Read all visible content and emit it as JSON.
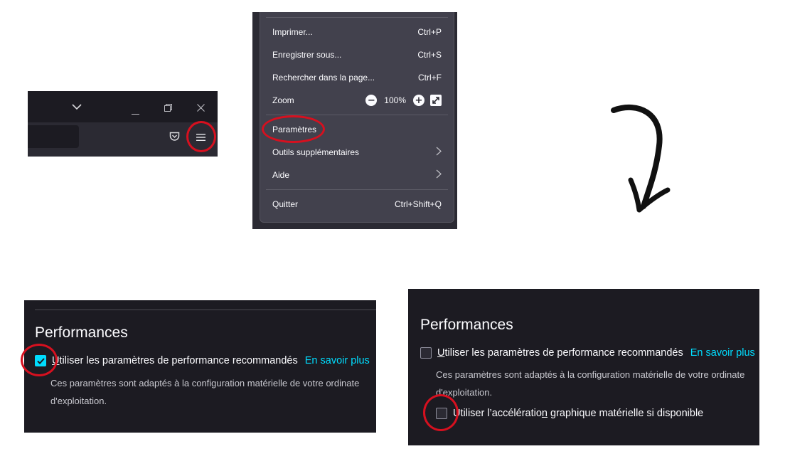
{
  "toolbar": {
    "icons": [
      "chevron-down-icon",
      "minimize-icon",
      "restore-icon",
      "close-icon",
      "pocket-icon",
      "hamburger-menu-icon"
    ]
  },
  "menu": {
    "items": [
      {
        "label": "Imprimer...",
        "shortcut": "Ctrl+P"
      },
      {
        "label": "Enregistrer sous...",
        "shortcut": "Ctrl+S"
      },
      {
        "label": "Rechercher dans la page...",
        "shortcut": "Ctrl+F"
      }
    ],
    "zoom": {
      "label": "Zoom",
      "minus": "−",
      "value": "100%",
      "plus": "+"
    },
    "settings_label": "Paramètres",
    "more_tools_label": "Outils supplémentaires",
    "help_label": "Aide",
    "quit": {
      "label": "Quitter",
      "shortcut": "Ctrl+Shift+Q"
    }
  },
  "before": {
    "title": "Performances",
    "recommended_label_first": "U",
    "recommended_label_rest": "tiliser les paramètres de performance recommandés",
    "learn_more": "En savoir plus",
    "desc_line1": "Ces paramètres sont adaptés à la configuration matérielle de votre ordinate",
    "desc_line2": "d'exploitation.",
    "recommended_checked": true
  },
  "after": {
    "title": "Performances",
    "recommended_label_first": "U",
    "recommended_label_rest": "tiliser les paramètres de performance recommandés",
    "learn_more": "En savoir plus",
    "desc_line1": "Ces paramètres sont adaptés à la configuration matérielle de votre ordinate",
    "desc_line2": "d'exploitation.",
    "hwaccel_label_a": "Utiliser l’accélératio",
    "hwaccel_label_u": "n",
    "hwaccel_label_b": " graphique matérielle si disponible",
    "recommended_checked": false,
    "hwaccel_checked": false
  },
  "colors": {
    "annotation": "#d6101f",
    "accent": "#00ddff",
    "panel_bg": "#1c1b22",
    "menu_bg": "#42414d"
  }
}
